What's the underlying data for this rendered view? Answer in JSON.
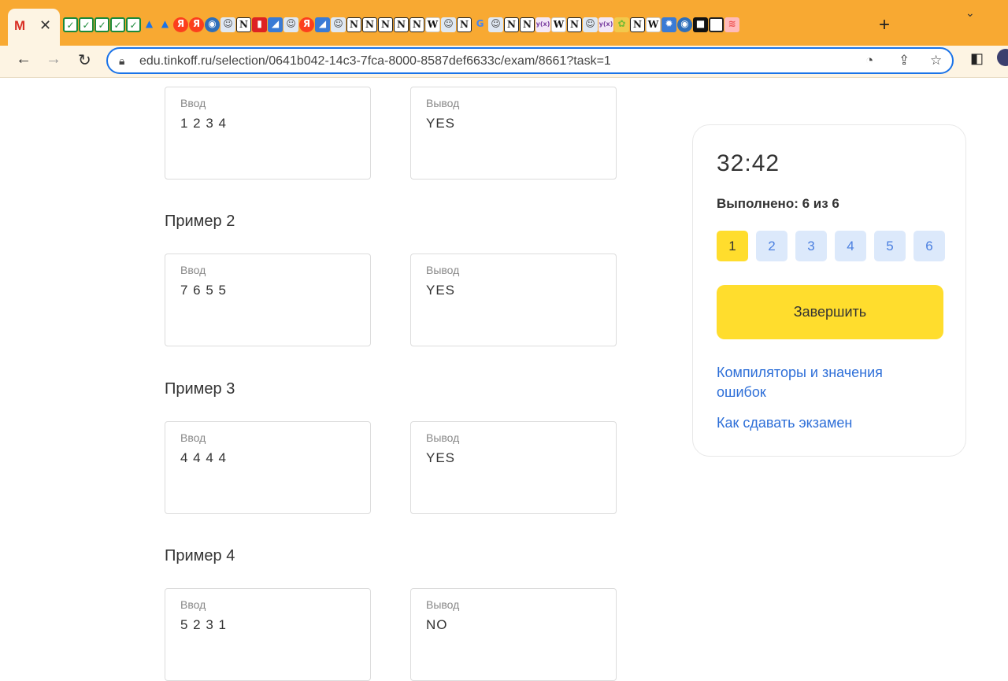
{
  "browser": {
    "active_tab_icon": "M",
    "close_symbol": "✕",
    "new_tab_symbol": "+",
    "tab_menu_symbol": "⌄",
    "url": "edu.tinkoff.ru/selection/0641b042-14c3-7fca-8000-8587def6633c/exam/8661?task=1",
    "favicons": [
      {
        "icon": "check-icon",
        "type": "check",
        "glyph": "✓"
      },
      {
        "icon": "check-icon",
        "type": "check",
        "glyph": "✓"
      },
      {
        "icon": "check-icon",
        "type": "check",
        "glyph": "✓"
      },
      {
        "icon": "check-icon",
        "type": "check",
        "glyph": "✓"
      },
      {
        "icon": "check-icon",
        "type": "check",
        "glyph": "✓"
      },
      {
        "icon": "drive-icon",
        "type": "drive",
        "glyph": "▲"
      },
      {
        "icon": "drive-icon",
        "type": "drive",
        "glyph": "▲"
      },
      {
        "icon": "yandex-icon",
        "type": "ya",
        "glyph": "Я"
      },
      {
        "icon": "yandex-icon",
        "type": "ya",
        "glyph": "Я"
      },
      {
        "icon": "globe-icon",
        "type": "globe",
        "glyph": "◉"
      },
      {
        "icon": "person-icon",
        "type": "person",
        "glyph": "☺"
      },
      {
        "icon": "notion-icon",
        "type": "notion",
        "glyph": "N"
      },
      {
        "icon": "bookmark-icon",
        "type": "red",
        "glyph": "▮"
      },
      {
        "icon": "image-icon",
        "type": "img",
        "glyph": "◢"
      },
      {
        "icon": "person-icon",
        "type": "person",
        "glyph": "☺"
      },
      {
        "icon": "yandex-icon",
        "type": "ya",
        "glyph": "Я"
      },
      {
        "icon": "image-icon",
        "type": "img",
        "glyph": "◢"
      },
      {
        "icon": "person-icon",
        "type": "person",
        "glyph": "☺"
      },
      {
        "icon": "notion-icon",
        "type": "notion",
        "glyph": "N"
      },
      {
        "icon": "notion-icon",
        "type": "notion",
        "glyph": "N"
      },
      {
        "icon": "notion-icon",
        "type": "notion",
        "glyph": "N"
      },
      {
        "icon": "notion-icon",
        "type": "notion",
        "glyph": "N"
      },
      {
        "icon": "notion-icon",
        "type": "notion",
        "glyph": "N"
      },
      {
        "icon": "wikipedia-icon",
        "type": "wiki",
        "glyph": "W"
      },
      {
        "icon": "person-icon",
        "type": "person",
        "glyph": "☺"
      },
      {
        "icon": "notion-icon",
        "type": "notion",
        "glyph": "N"
      },
      {
        "icon": "google-icon",
        "type": "goog",
        "glyph": "G"
      },
      {
        "icon": "person-icon",
        "type": "person",
        "glyph": "☺"
      },
      {
        "icon": "notion-icon",
        "type": "notion",
        "glyph": "N"
      },
      {
        "icon": "notion-icon",
        "type": "notion",
        "glyph": "N"
      },
      {
        "icon": "formula-icon",
        "type": "yx",
        "glyph": "y(x)"
      },
      {
        "icon": "wikipedia-icon",
        "type": "wiki",
        "glyph": "W"
      },
      {
        "icon": "notion-icon",
        "type": "notion",
        "glyph": "N"
      },
      {
        "icon": "person-icon",
        "type": "person",
        "glyph": "☺"
      },
      {
        "icon": "formula-icon",
        "type": "yx",
        "glyph": "y(x)"
      },
      {
        "icon": "people-icon",
        "type": "ppl",
        "glyph": "✿"
      },
      {
        "icon": "notion-icon",
        "type": "notion",
        "glyph": "N"
      },
      {
        "icon": "wikipedia-icon",
        "type": "wiki",
        "glyph": "W"
      },
      {
        "icon": "puzzle-icon",
        "type": "img",
        "glyph": "✹"
      },
      {
        "icon": "globe-icon",
        "type": "globe",
        "glyph": "◉"
      },
      {
        "icon": "square-icon",
        "type": "dark",
        "glyph": "■"
      },
      {
        "icon": "square-outline-icon",
        "type": "box",
        "glyph": ""
      },
      {
        "icon": "stack-icon",
        "type": "orange",
        "glyph": "≋"
      }
    ]
  },
  "examples": [
    {
      "title": "",
      "input_label": "Ввод",
      "input": "1 2 3 4",
      "output_label": "Вывод",
      "output": "YES"
    },
    {
      "title": "Пример 2",
      "input_label": "Ввод",
      "input": "7 6 5 5",
      "output_label": "Вывод",
      "output": "YES"
    },
    {
      "title": "Пример 3",
      "input_label": "Ввод",
      "input": "4 4 4 4",
      "output_label": "Вывод",
      "output": "YES"
    },
    {
      "title": "Пример 4",
      "input_label": "Ввод",
      "input": "5 2 3 1",
      "output_label": "Вывод",
      "output": "NO"
    }
  ],
  "panel": {
    "timer": "32:42",
    "progress": "Выполнено: 6 из 6",
    "tasks": [
      "1",
      "2",
      "3",
      "4",
      "5",
      "6"
    ],
    "active_task": "1",
    "finish_label": "Завершить",
    "link_compilers": "Компиляторы и значения ошибок",
    "link_how": "Как сдавать экзамен"
  }
}
